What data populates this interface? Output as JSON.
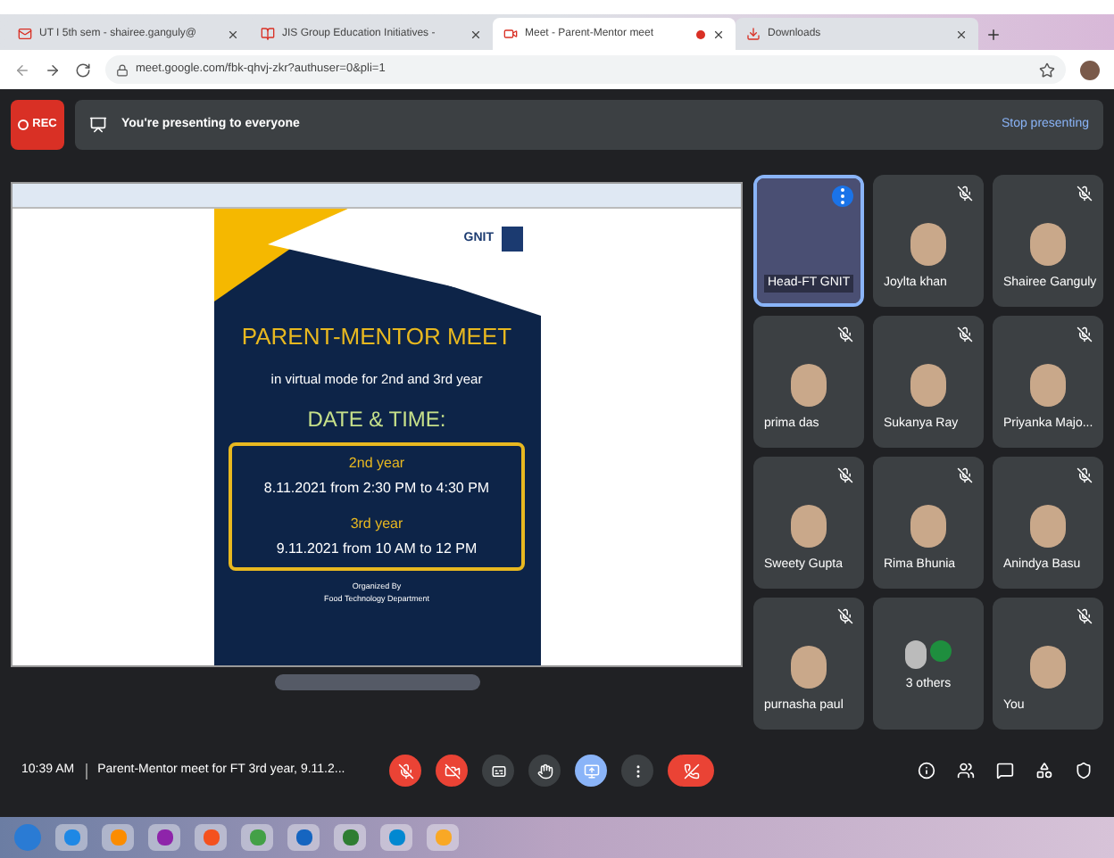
{
  "browser": {
    "tabs": [
      {
        "label": "UT I 5th sem - shairee.ganguly@",
        "kind": "mail",
        "selected": false
      },
      {
        "label": "JIS Group Education Initiatives -",
        "kind": "classroom",
        "selected": false
      },
      {
        "label": "Meet - Parent-Mentor meet",
        "kind": "meet",
        "selected": true,
        "recording": true
      },
      {
        "label": "Downloads",
        "kind": "download",
        "selected": false
      }
    ],
    "url": "meet.google.com/fbk-qhvj-zkr?authuser=0&pli=1"
  },
  "meet": {
    "rec_label": "REC",
    "banner": "You're presenting to everyone",
    "stop_presenting": "Stop presenting",
    "slide": {
      "logo": "GNIT",
      "title": "PARENT-MENTOR MEET",
      "subtitle": "in virtual mode for 2nd and 3rd year",
      "heading": "DATE & TIME:",
      "schedule": [
        {
          "year": "2nd year",
          "time": "8.11.2021 from 2:30 PM to 4:30 PM"
        },
        {
          "year": "3rd year",
          "time": "9.11.2021 from 10 AM to 12 PM"
        }
      ],
      "footer": [
        "Organized By",
        "Food Technology Department"
      ]
    },
    "participants": [
      {
        "name": "Head-FT GNIT",
        "kind": "video",
        "muted": false,
        "selected": true
      },
      {
        "name": "Joylta khan",
        "kind": "avatar",
        "muted": true,
        "selected": false
      },
      {
        "name": "Shairee Ganguly",
        "kind": "avatar",
        "muted": true,
        "selected": false
      },
      {
        "name": "prima das",
        "kind": "avatar",
        "muted": true,
        "selected": false
      },
      {
        "name": "Sukanya Ray",
        "kind": "avatar",
        "muted": true,
        "selected": false
      },
      {
        "name": "Priyanka Majo...",
        "kind": "avatar",
        "muted": true,
        "selected": false
      },
      {
        "name": "Sweety Gupta",
        "kind": "avatar",
        "muted": true,
        "selected": false
      },
      {
        "name": "Rima Bhunia",
        "kind": "avatar",
        "muted": true,
        "selected": false
      },
      {
        "name": "Anindya Basu",
        "kind": "avatar",
        "muted": true,
        "selected": false
      },
      {
        "name": "purnasha paul",
        "kind": "avatar",
        "muted": true,
        "selected": false
      },
      {
        "name": "3 others",
        "kind": "group",
        "muted": false,
        "selected": false
      },
      {
        "name": "You",
        "kind": "avatar",
        "muted": true,
        "selected": false
      }
    ],
    "time": "10:39 AM",
    "meeting_title": "Parent-Mentor meet for FT 3rd year, 9.11.2...",
    "controls": [
      {
        "kind": "mic",
        "on": false
      },
      {
        "kind": "camera",
        "on": false
      },
      {
        "kind": "captions",
        "on": false
      },
      {
        "kind": "hand",
        "on": false
      },
      {
        "kind": "present",
        "on": true
      },
      {
        "kind": "more",
        "on": false
      },
      {
        "kind": "leave"
      }
    ],
    "side_controls": [
      {
        "kind": "info"
      },
      {
        "kind": "people"
      },
      {
        "kind": "chat"
      },
      {
        "kind": "activities"
      },
      {
        "kind": "safety"
      }
    ]
  }
}
